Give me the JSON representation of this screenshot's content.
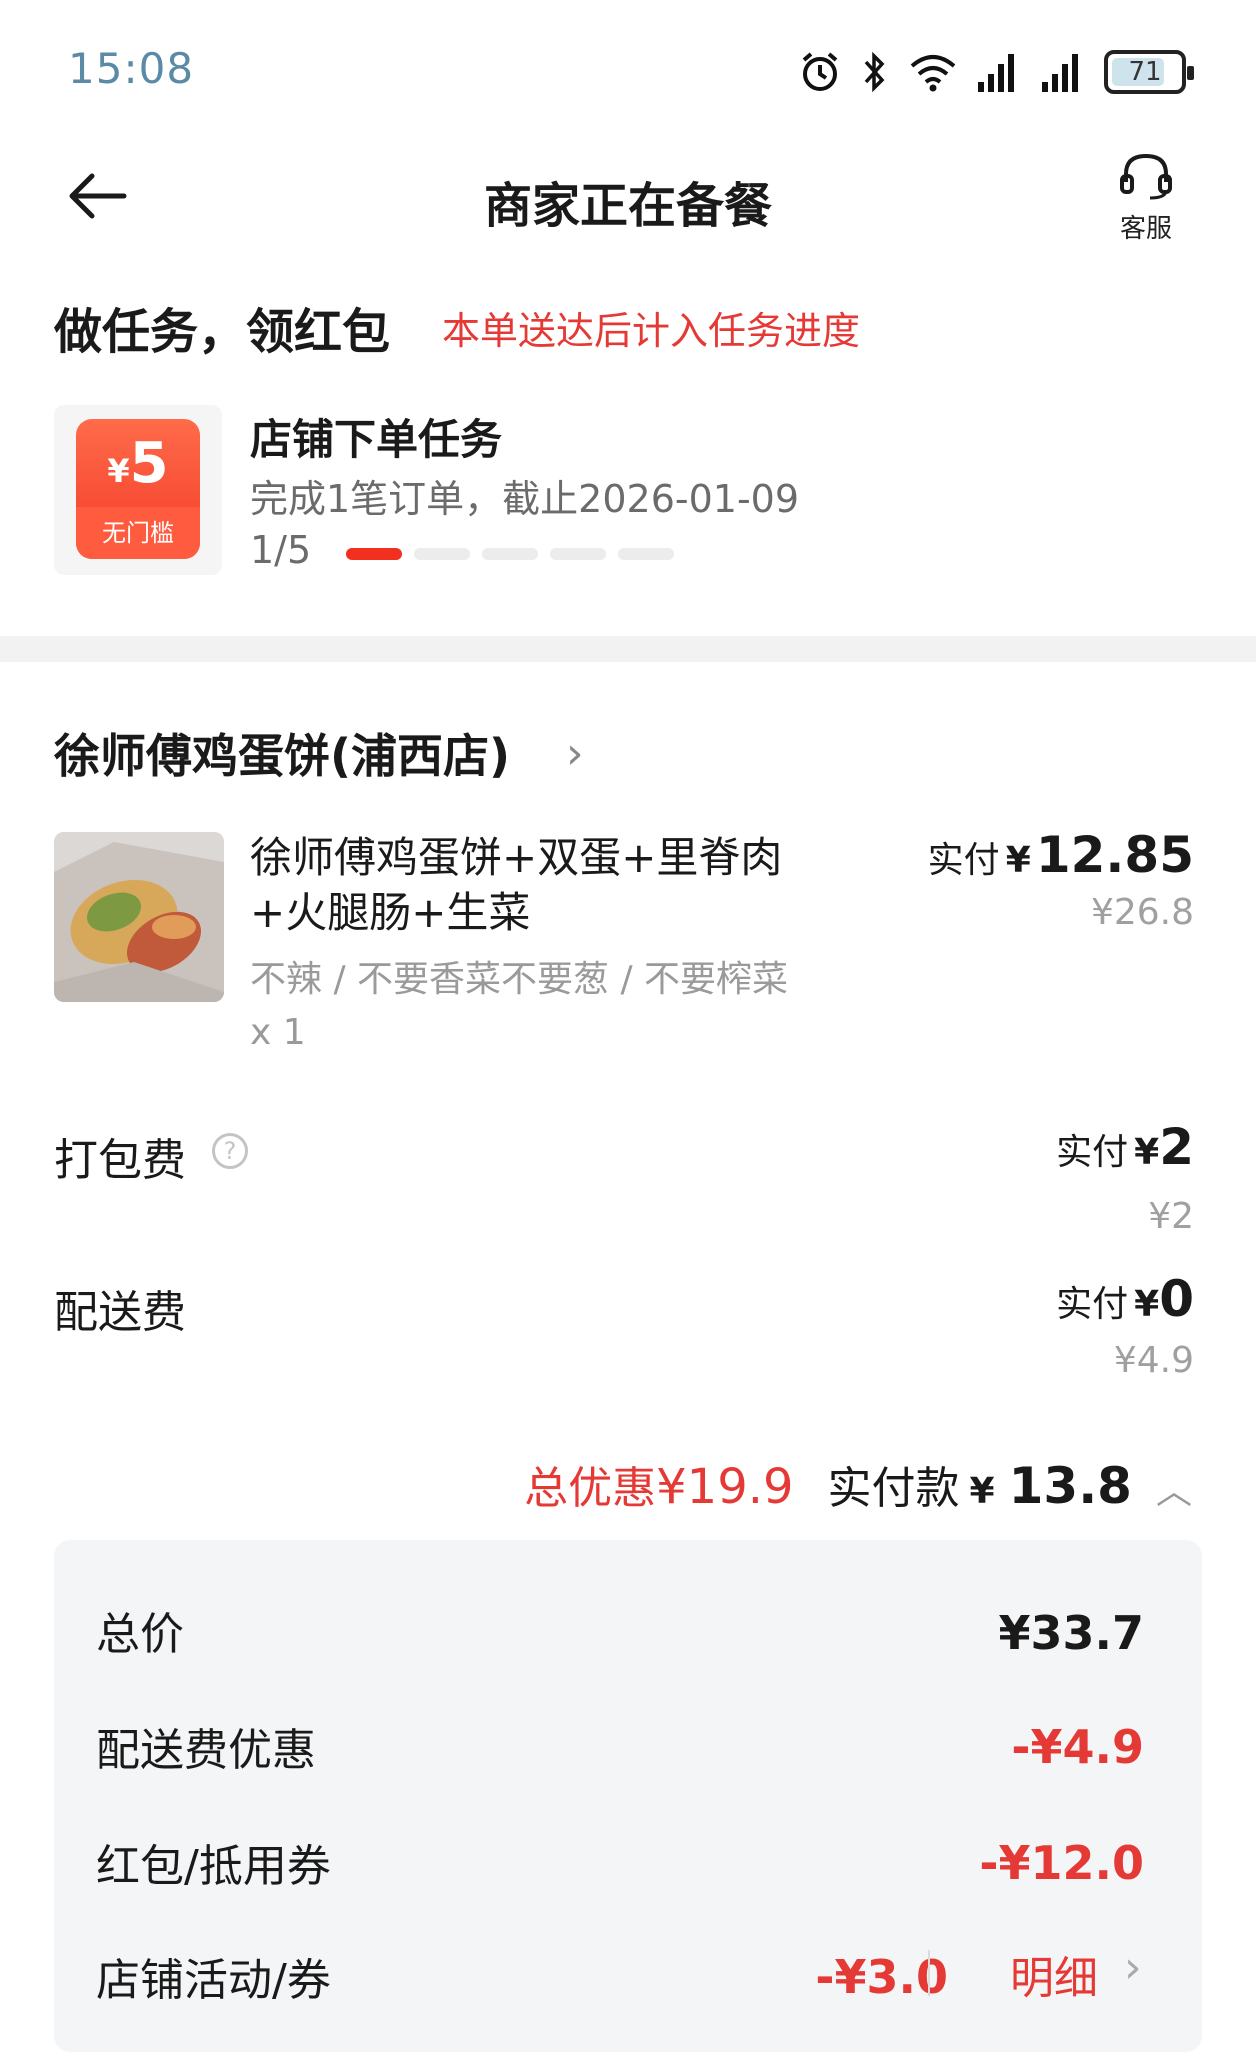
{
  "status_bar": {
    "time": "15:08",
    "battery": "71"
  },
  "header": {
    "title": "商家正在备餐",
    "service_label": "客服"
  },
  "task": {
    "heading": "做任务，领红包",
    "note": "本单送达后计入任务进度",
    "coupon_yen": "¥",
    "coupon_amount": "5",
    "coupon_tag": "无门槛",
    "title": "店铺下单任务",
    "desc": "完成1笔订单，截止2026-01-09",
    "progress_text": "1/5",
    "progress_done": 1,
    "progress_total": 5
  },
  "shop": {
    "name": "徐师傅鸡蛋饼(浦西店)"
  },
  "item": {
    "name": "徐师傅鸡蛋饼+双蛋+里脊肉+火腿肠+生菜",
    "spec": "不辣 / 不要香菜不要葱 / 不要榨菜",
    "qty": "x 1",
    "paid_label": "实付",
    "yen": "¥",
    "paid_value": "12.85",
    "original_price": "¥26.8"
  },
  "fees": {
    "packing_label": "打包费",
    "packing_paid_label": "实付",
    "packing_yen": "¥",
    "packing_paid": "2",
    "packing_original": "¥2",
    "delivery_label": "配送费",
    "delivery_paid_label": "实付",
    "delivery_yen": "¥",
    "delivery_paid": "0",
    "delivery_original": "¥4.9"
  },
  "summary": {
    "discount_label": "总优惠",
    "discount_value": "¥19.9",
    "paid_label": "实付款",
    "paid_yen": "¥",
    "paid_value": "13.8"
  },
  "breakdown": {
    "total_label": "总价",
    "total_value": "¥33.7",
    "delivery_discount_label": "配送费优惠",
    "delivery_discount_value": "-¥4.9",
    "coupon_label": "红包/抵用券",
    "coupon_value": "-¥12.0",
    "shop_promo_label": "店铺活动/券",
    "shop_promo_value": "-¥3.0",
    "detail_link": "明细"
  },
  "colors": {
    "accent_red": "#e53935",
    "time_blue": "#5a8aa6"
  }
}
